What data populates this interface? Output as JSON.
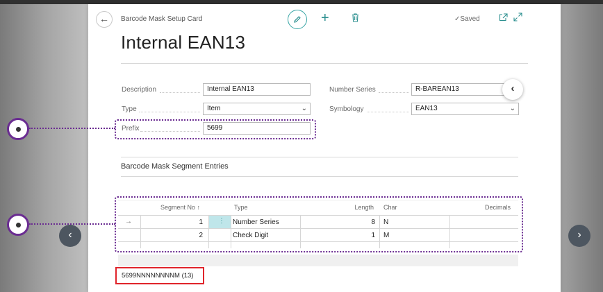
{
  "header": {
    "breadcrumb": "Barcode Mask Setup Card",
    "saved_status": "Saved",
    "title": "Internal EAN13"
  },
  "fields": {
    "description": {
      "label": "Description",
      "value": "Internal EAN13"
    },
    "type": {
      "label": "Type",
      "value": "Item"
    },
    "prefix": {
      "label": "Prefix",
      "value": "5699"
    },
    "number_series": {
      "label": "Number Series",
      "value": "R-BAREAN13"
    },
    "symbology": {
      "label": "Symbology",
      "value": "EAN13"
    }
  },
  "segments": {
    "title": "Barcode Mask Segment Entries",
    "columns": {
      "segment_no": "Segment No ↑",
      "type": "Type",
      "length": "Length",
      "char": "Char",
      "decimals": "Decimals"
    },
    "rows": [
      {
        "indicator": "→",
        "segment_no": "1",
        "type": "Number Series",
        "length": "8",
        "char": "N",
        "decimals": ""
      },
      {
        "indicator": "",
        "segment_no": "2",
        "type": "Check Digit",
        "length": "1",
        "char": "M",
        "decimals": ""
      }
    ]
  },
  "mask_result": "5699NNNNNNNNM (13)",
  "icons": {
    "back": "back-arrow-icon",
    "edit": "pencil-icon",
    "new": "plus-icon",
    "delete": "trash-icon",
    "saved": "check-icon",
    "open_new_window": "open-in-new-window-icon",
    "expand": "expand-icon",
    "collapse": "chevron-left-icon",
    "prev": "chevron-left-icon",
    "next": "chevron-right-icon"
  },
  "colors": {
    "accent": "#2b8f8f",
    "annotation": "#6a2c91",
    "highlight_box": "#e0242b",
    "selected_cell": "#bfe6ea"
  }
}
